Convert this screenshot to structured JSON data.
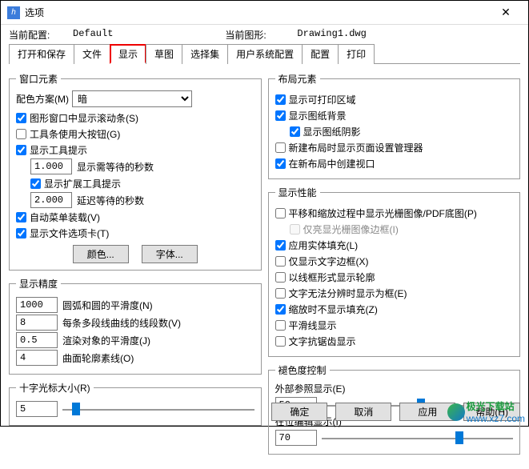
{
  "window": {
    "title": "选项",
    "close": "✕"
  },
  "header": {
    "currentConfigLabel": "当前配置:",
    "currentConfigValue": "Default",
    "currentDrawingLabel": "当前图形:",
    "currentDrawingValue": "Drawing1.dwg"
  },
  "tabs": {
    "openSave": "打开和保存",
    "files": "文件",
    "display": "显示",
    "draft": "草图",
    "selection": "选择集",
    "userSys": "用户系统配置",
    "config": "配置",
    "print": "打印"
  },
  "windowElements": {
    "legend": "窗口元素",
    "colorSchemeLabel": "配色方案(M)",
    "colorSchemeValue": "暗",
    "scrollBars": "图形窗口中显示滚动条(S)",
    "largeButtons": "工具条使用大按钮(G)",
    "showTooltips": "显示工具提示",
    "secBeforeDisplay": "显示需等待的秒数",
    "secBeforeValue": "1.000",
    "showExtTooltips": "显示扩展工具提示",
    "delaySec": "延迟等待的秒数",
    "delayValue": "2.000",
    "autoMenuLoad": "自动菜单装载(V)",
    "showFileTabs": "显示文件选项卡(T)",
    "colorBtn": "颜色...",
    "fontBtn": "字体..."
  },
  "displayAccuracy": {
    "legend": "显示精度",
    "arcSmooth": "圆弧和圆的平滑度(N)",
    "arcValue": "1000",
    "polySegs": "每条多段线曲线的线段数(V)",
    "polyValue": "8",
    "renderSmooth": "渲染对象的平滑度(J)",
    "renderValue": "0.5",
    "contourLines": "曲面轮廓素线(O)",
    "contourValue": "4"
  },
  "crosshair": {
    "legend": "十字光标大小(R)",
    "value": "5"
  },
  "layoutElements": {
    "legend": "布局元素",
    "showPrintable": "显示可打印区域",
    "showPaperBg": "显示图纸背景",
    "showPaperShadow": "显示图纸阴影",
    "newLayoutPageSetup": "新建布局时显示页面设置管理器",
    "createViewport": "在新布局中创建视口"
  },
  "displayPerformance": {
    "legend": "显示性能",
    "panZoomRaster": "平移和缩放过程中显示光栅图像/PDF底图(P)",
    "rasterFrameOnly": "仅亮显光栅图像边框(I)",
    "applySolidFill": "应用实体填充(L)",
    "textFrameOnly": "仅显示文字边框(X)",
    "wireframeSilh": "以线框形式显示轮廓",
    "textTrueSize": "文字无法分辨时显示为框(E)",
    "noFillOnZoom": "缩放时不显示填充(Z)",
    "smoothLine": "平滑线显示",
    "textAntialias": "文字抗锯齿显示"
  },
  "fadeControl": {
    "legend": "褪色度控制",
    "externalRef": "外部参照显示(E)",
    "externalValue": "50",
    "inPlaceEdit": "在位编辑显示(I)",
    "inPlaceValue": "70"
  },
  "footer": {
    "ok": "确定",
    "cancel": "取消",
    "apply": "应用",
    "help": "帮助(H)"
  },
  "watermark": {
    "text1": "极光下载站",
    "text2": "www.xz7.com"
  }
}
